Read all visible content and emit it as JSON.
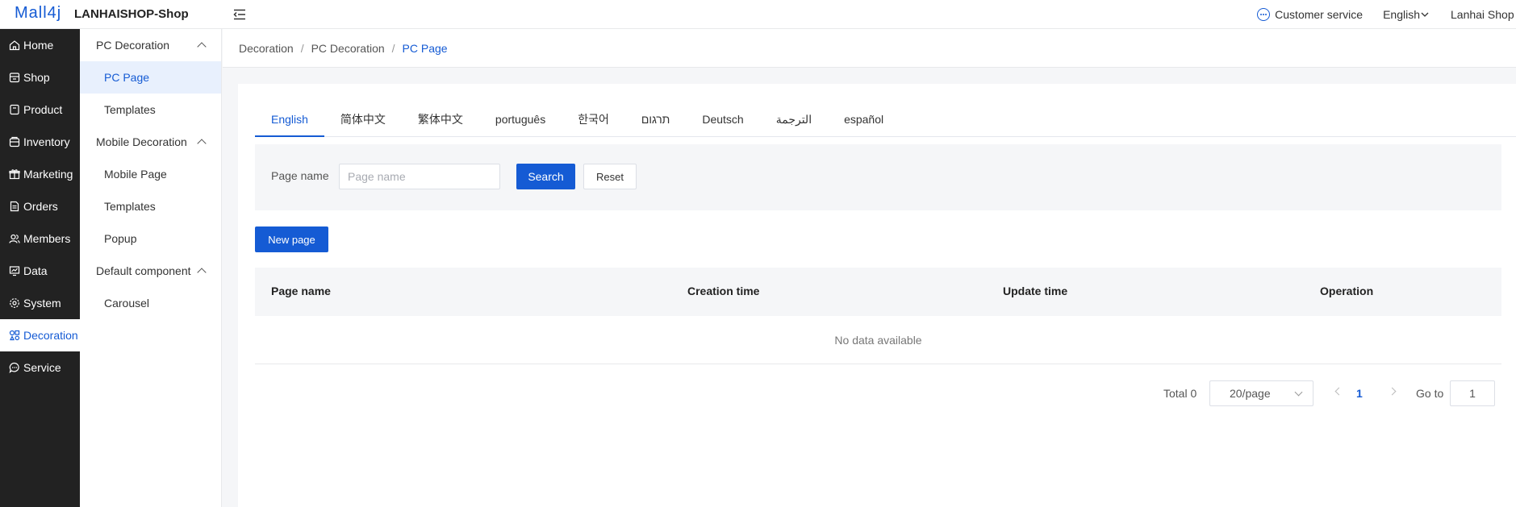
{
  "header": {
    "logo_text": "Mall4j",
    "shop_name": "LANHAISHOP-Shop",
    "customer_service": "Customer service",
    "language": "English",
    "user": "Lanhai Shop"
  },
  "main_nav": [
    {
      "label": "Home",
      "icon": "home-icon"
    },
    {
      "label": "Shop",
      "icon": "shop-icon"
    },
    {
      "label": "Product",
      "icon": "product-icon"
    },
    {
      "label": "Inventory",
      "icon": "inventory-icon"
    },
    {
      "label": "Marketing",
      "icon": "gift-icon"
    },
    {
      "label": "Orders",
      "icon": "document-icon"
    },
    {
      "label": "Members",
      "icon": "users-icon"
    },
    {
      "label": "Data",
      "icon": "chart-icon"
    },
    {
      "label": "System",
      "icon": "gear-icon"
    },
    {
      "label": "Decoration",
      "icon": "decoration-icon",
      "active": true
    },
    {
      "label": "Service",
      "icon": "chat-icon"
    }
  ],
  "sub_nav": {
    "groups": [
      {
        "label": "PC Decoration",
        "items": [
          "PC Page",
          "Templates"
        ]
      },
      {
        "label": "Mobile Decoration",
        "items": [
          "Mobile Page",
          "Templates",
          "Popup"
        ]
      },
      {
        "label": "Default component",
        "items": [
          "Carousel"
        ]
      }
    ],
    "active": "PC Page"
  },
  "breadcrumb": [
    "Decoration",
    "PC Decoration",
    "PC Page"
  ],
  "tabs": [
    "English",
    "简体中文",
    "繁体中文",
    "português",
    "한국어",
    "תרגום",
    "Deutsch",
    "الترجمة",
    "español"
  ],
  "active_tab": "English",
  "search": {
    "label": "Page name",
    "placeholder": "Page name",
    "value": "",
    "search_button": "Search",
    "reset_button": "Reset"
  },
  "new_page_button": "New page",
  "table": {
    "columns": [
      "Page name",
      "Creation time",
      "Update time",
      "Operation"
    ],
    "rows": [],
    "empty_text": "No data available"
  },
  "pagination": {
    "total_label": "Total 0",
    "page_size": "20/page",
    "current_page": "1",
    "goto_label": "Go to",
    "goto_value": "1"
  },
  "colors": {
    "accent": "#155bd4",
    "sidebar_bg": "#222222"
  }
}
